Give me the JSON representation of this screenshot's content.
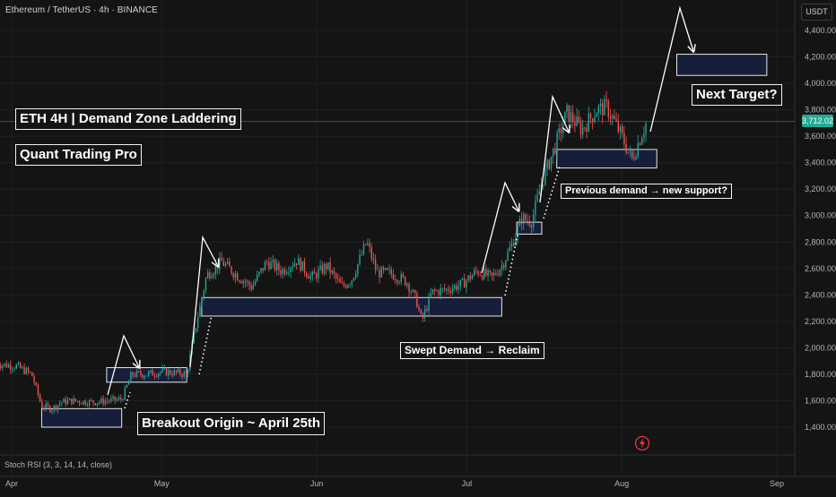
{
  "header": {
    "symbol": "Ethereum / TetherUS · 4h · BINANCE",
    "currency": "USDT"
  },
  "colors": {
    "background": "#141414",
    "grid": "#1f2126",
    "candle_up": "#26a69a",
    "candle_down": "#ef5350",
    "zone_fill": "#172040",
    "zone_border": "#e6e6e6",
    "annotation_line": "#ffffff",
    "price_tag": "#22ab94"
  },
  "annotations": {
    "title": "ETH 4H | Demand Zone Laddering",
    "brand": "Quant Trading Pro",
    "next_target": "Next Target?",
    "breakout_origin": "Breakout Origin ~ April 25th",
    "swept_demand": "Swept Demand → Reclaim",
    "previous_demand": "Previous demand → new support?"
  },
  "indicator": {
    "label": "Stoch RSI (3, 3, 14, 14, close)"
  },
  "price_tag": "3,712.02",
  "icons": [
    "lightning-bolt-icon"
  ],
  "chart_data": {
    "type": "candlestick",
    "y_axis": {
      "range": [
        1300,
        4500
      ],
      "ticks": [
        1400,
        1600,
        1800,
        2000,
        2200,
        2400,
        2600,
        2800,
        3000,
        3200,
        3400,
        3600,
        3800,
        4000,
        4200,
        4400
      ],
      "tick_labels": [
        "1,400.00",
        "1,600.00",
        "1,800.00",
        "2,000.00",
        "2,200.00",
        "2,400.00",
        "2,600.00",
        "2,800.00",
        "3,000.00",
        "3,200.00",
        "3,400.00",
        "3,600.00",
        "3,800.00",
        "4,000.00",
        "4,200.00",
        "4,400.00"
      ]
    },
    "x_axis": {
      "range": [
        "2025-04-01",
        "2025-09-03"
      ],
      "tick_labels": [
        {
          "label": "Apr",
          "date": "2025-04-01"
        },
        {
          "label": "May",
          "date": "2025-05-01"
        },
        {
          "label": "Jun",
          "date": "2025-06-01"
        },
        {
          "label": "Jul",
          "date": "2025-07-01"
        },
        {
          "label": "Aug",
          "date": "2025-08-01"
        },
        {
          "label": "Sep",
          "date": "2025-09-01"
        }
      ]
    },
    "grid": true,
    "price_path": [
      [
        "2025-03-29",
        1880
      ],
      [
        "2025-04-02",
        1860
      ],
      [
        "2025-04-05",
        1800
      ],
      [
        "2025-04-07",
        1560
      ],
      [
        "2025-04-09",
        1540
      ],
      [
        "2025-04-11",
        1590
      ],
      [
        "2025-04-13",
        1600
      ],
      [
        "2025-04-16",
        1590
      ],
      [
        "2025-04-18",
        1590
      ],
      [
        "2025-04-20",
        1600
      ],
      [
        "2025-04-23",
        1610
      ],
      [
        "2025-04-25",
        1800
      ],
      [
        "2025-04-28",
        1800
      ],
      [
        "2025-05-01",
        1820
      ],
      [
        "2025-05-04",
        1810
      ],
      [
        "2025-05-06",
        1800
      ],
      [
        "2025-05-08",
        2200
      ],
      [
        "2025-05-10",
        2550
      ],
      [
        "2025-05-13",
        2650
      ],
      [
        "2025-05-16",
        2550
      ],
      [
        "2025-05-19",
        2460
      ],
      [
        "2025-05-22",
        2650
      ],
      [
        "2025-05-25",
        2580
      ],
      [
        "2025-05-28",
        2660
      ],
      [
        "2025-05-31",
        2530
      ],
      [
        "2025-06-03",
        2620
      ],
      [
        "2025-06-06",
        2460
      ],
      [
        "2025-06-08",
        2520
      ],
      [
        "2025-06-11",
        2800
      ],
      [
        "2025-06-13",
        2570
      ],
      [
        "2025-06-16",
        2560
      ],
      [
        "2025-06-19",
        2500
      ],
      [
        "2025-06-21",
        2350
      ],
      [
        "2025-06-22",
        2200
      ],
      [
        "2025-06-24",
        2420
      ],
      [
        "2025-06-27",
        2440
      ],
      [
        "2025-06-30",
        2480
      ],
      [
        "2025-07-03",
        2580
      ],
      [
        "2025-07-06",
        2530
      ],
      [
        "2025-07-08",
        2620
      ],
      [
        "2025-07-10",
        2780
      ],
      [
        "2025-07-12",
        2980
      ],
      [
        "2025-07-14",
        2960
      ],
      [
        "2025-07-16",
        3250
      ],
      [
        "2025-07-19",
        3560
      ],
      [
        "2025-07-21",
        3780
      ],
      [
        "2025-07-24",
        3650
      ],
      [
        "2025-07-27",
        3800
      ],
      [
        "2025-07-29",
        3820
      ],
      [
        "2025-08-01",
        3600
      ],
      [
        "2025-08-03",
        3420
      ],
      [
        "2025-08-05",
        3620
      ],
      [
        "2025-08-06",
        3712
      ]
    ],
    "demand_zones": [
      {
        "from": "2025-04-07",
        "to": "2025-04-23",
        "low": 1400,
        "high": 1540
      },
      {
        "from": "2025-04-20",
        "to": "2025-05-06",
        "low": 1740,
        "high": 1850
      },
      {
        "from": "2025-05-09",
        "to": "2025-07-08",
        "low": 2240,
        "high": 2380
      },
      {
        "from": "2025-07-11",
        "to": "2025-07-16",
        "low": 2860,
        "high": 2950
      },
      {
        "from": "2025-07-19",
        "to": "2025-08-08",
        "low": 3360,
        "high": 3500
      }
    ],
    "target_zone": {
      "from": "2025-08-12",
      "to": "2025-08-30",
      "low": 4060,
      "high": 4220
    },
    "current_price": 3712.02
  }
}
